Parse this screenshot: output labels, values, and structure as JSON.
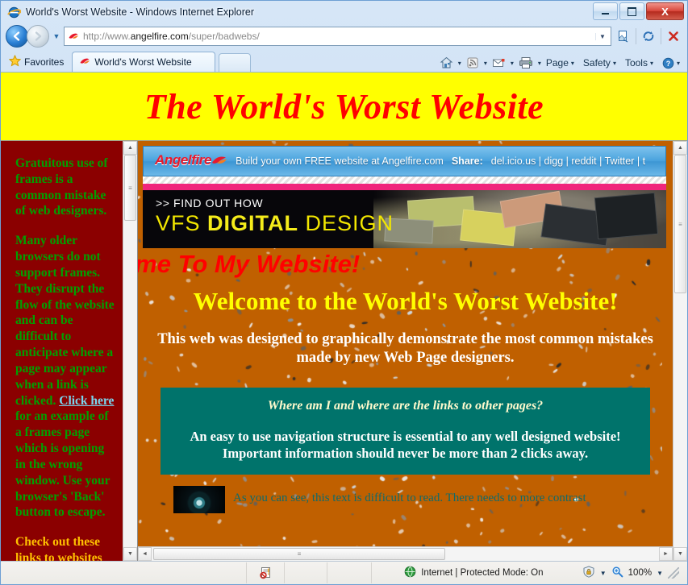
{
  "window": {
    "title": "World's Worst Website - Windows Internet Explorer",
    "minimize_label": "Minimize",
    "maximize_label": "Maximize",
    "close_label": "X"
  },
  "address_bar": {
    "back_label": "Back",
    "forward_label": "Forward",
    "history_caret": "▼",
    "url_scheme": "http://www.",
    "url_domain": "angelfire.com",
    "url_path": "/super/badwebs/",
    "url_full": "http://www.angelfire.com/super/badwebs/",
    "dropdown_caret": "▼",
    "compat_label": "Compatibility View",
    "refresh_label": "Refresh",
    "stop_label": "Stop"
  },
  "tabs": {
    "favorites_label": "Favorites",
    "items": [
      {
        "label": "World's Worst Website"
      }
    ],
    "new_tab_label": "New Tab"
  },
  "command_bar": {
    "home_label": "Home",
    "feeds_label": "Feeds",
    "mail_label": "Read Mail",
    "print_label": "Print",
    "caret": "▾",
    "items": [
      {
        "label": "Page"
      },
      {
        "label": "Safety"
      },
      {
        "label": "Tools"
      }
    ],
    "help_label": "Help"
  },
  "page": {
    "banner_title": "The World's Worst Website",
    "left_frame": {
      "paragraphs": [
        "Gratuitous use of frames is a common mistake of web designers.",
        "Many older browsers do not support frames. They disrupt the flow of the website and can be difficult to anticipate where a page may appear when a link is clicked.",
        " for an example of a frames page which is opening in the wrong window. Use your browser's 'Back' button to escape."
      ],
      "link_label": "Click here",
      "gold_text": "Check out these links to websites whose opinions"
    },
    "angelfire_ad": {
      "logo": "Angelfire",
      "tagline": "Build your own FREE website at Angelfire.com",
      "share_label": "Share:",
      "share_links": "del.icio.us | digg | reddit | Twitter | t"
    },
    "vfs_ad": {
      "kicker": ">> FIND OUT HOW",
      "line_1": "VFS ",
      "line_2": "DIGITAL",
      "line_3": " DESIGN"
    },
    "marquee_text": "come To My Website!",
    "welcome_heading": "Welcome to the World's Worst Website!",
    "intro_line_1": "This web was designed to graphically demonstrate the most common mistakes",
    "intro_line_2": "made by new Web Page designers.",
    "nav_box": {
      "question": "Where am I and where are the links to other pages?",
      "answer_line_1": "An easy to use navigation structure is essential to any well designed website!",
      "answer_line_2": "Important information should never be more than 2 clicks away."
    },
    "low_contrast_text": "As you can see, this text is difficult to read. There needs to more contrast"
  },
  "scrollbars": {
    "up_arrow": "▲",
    "down_arrow": "▼",
    "left_arrow": "◄",
    "right_arrow": "►",
    "grip": "≡"
  },
  "status_bar": {
    "error_label": "Error on page",
    "zone_text": "Internet | Protected Mode: On",
    "zoom_label": "100%",
    "zoom_caret": "▼",
    "protected_caret": "▼"
  },
  "colors": {
    "banner_bg": "#ffff00",
    "banner_fg": "#ff0000",
    "left_frame_bg": "#8b0000",
    "left_frame_fg": "#00a000",
    "left_frame_link": "#7ad7f0",
    "left_frame_gold": "#ffc000",
    "page_bg": "#c06000",
    "welcome_fg": "#ffff00",
    "navbox_bg": "#00736b",
    "vfs_accent": "#f2e600",
    "angelfire_logo": "#e8192c"
  }
}
